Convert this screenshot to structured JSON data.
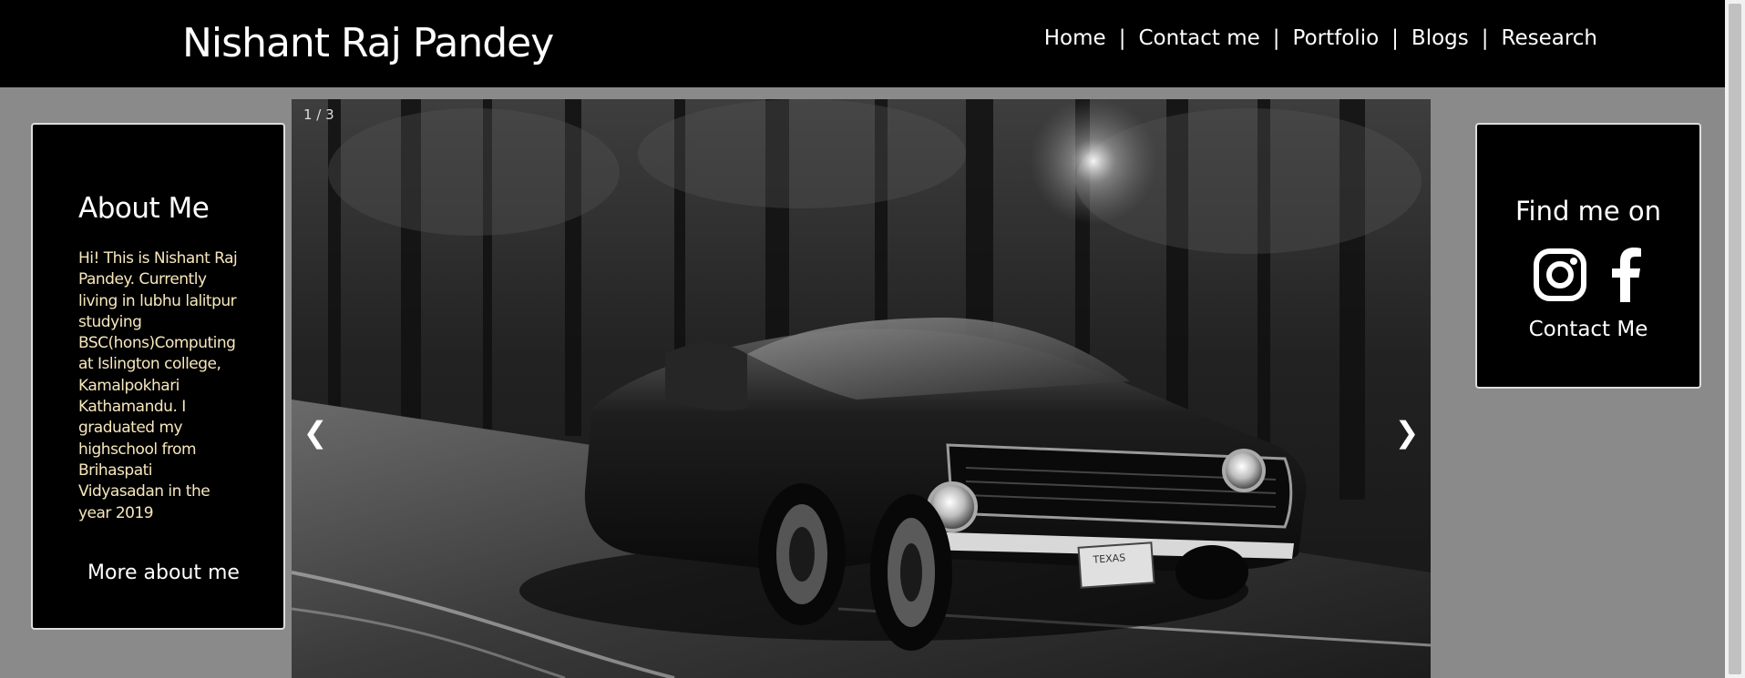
{
  "header": {
    "title": "Nishant Raj Pandey",
    "nav": [
      "Home",
      "Contact me",
      "Portfolio",
      "Blogs",
      "Research"
    ],
    "separator": "|"
  },
  "about": {
    "title": "About Me",
    "text": "Hi! This is Nishant Raj Pandey. Currently living in lubhu lalitpur studying BSC(hons)Computing at Islington college, Kamalpokhari Kathamandu. I graduated my highschool from Brihaspati Vidyasadan in the year 2019",
    "link": "More about me"
  },
  "slideshow": {
    "counter": "1 / 3",
    "prev": "❮",
    "next": "❯",
    "image": "black-and-white-muscle-car-on-forest-road",
    "plate_text": "TEXAS"
  },
  "findme": {
    "title": "Find me on",
    "icons": [
      "instagram-icon",
      "facebook-icon"
    ],
    "contact": "Contact Me"
  },
  "colors": {
    "header_bg": "#000000",
    "page_bg": "#8a8a8a",
    "card_bg": "#000000",
    "about_text": "#f6e7bd"
  }
}
